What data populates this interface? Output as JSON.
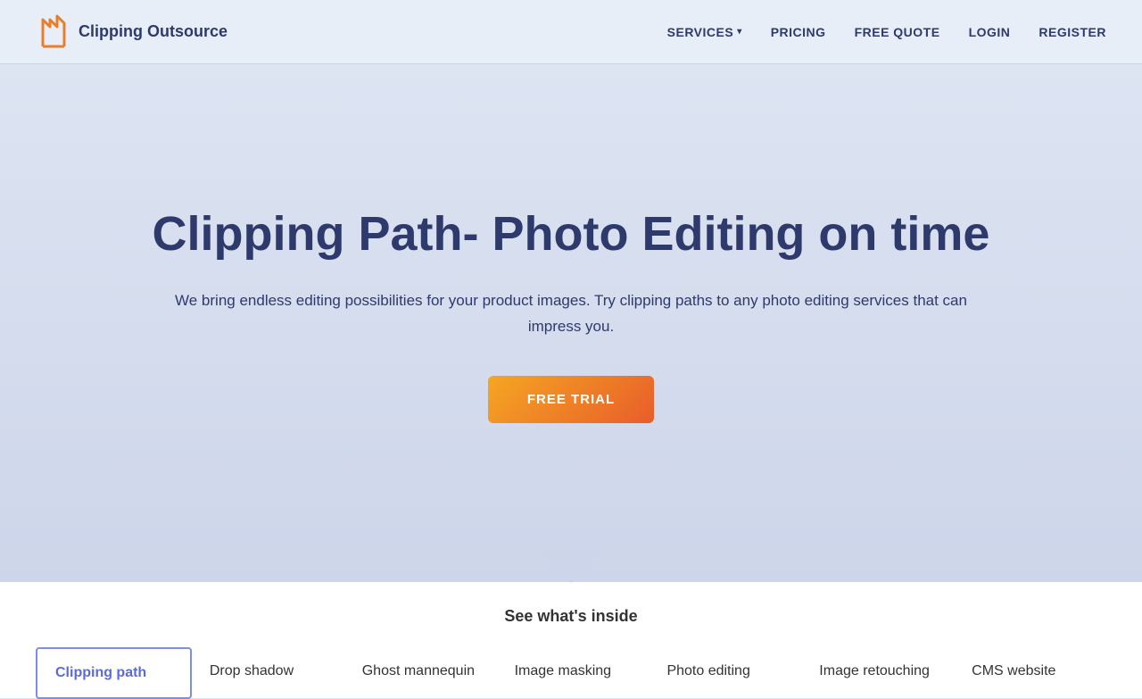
{
  "header": {
    "logo_text": "Clipping Outsource",
    "nav": {
      "services_label": "SERVICES",
      "pricing_label": "PRICING",
      "free_quote_label": "FREE QUOTE",
      "login_label": "LOGIN",
      "register_label": "REGISTER"
    }
  },
  "hero": {
    "title": "Clipping Path- Photo Editing on time",
    "subtitle": "We bring endless editing possibilities for your product images. Try clipping paths to any photo editing services that can impress you.",
    "cta_label": "FREE TRIAL"
  },
  "bottom": {
    "section_label": "See what's inside",
    "services": [
      {
        "name": "Clipping path",
        "active": true
      },
      {
        "name": "Drop shadow",
        "active": false
      },
      {
        "name": "Ghost mannequin",
        "active": false
      },
      {
        "name": "Image masking",
        "active": false
      },
      {
        "name": "Photo editing",
        "active": false
      },
      {
        "name": "Image retouching",
        "active": false
      },
      {
        "name": "CMS website",
        "active": false
      }
    ]
  }
}
